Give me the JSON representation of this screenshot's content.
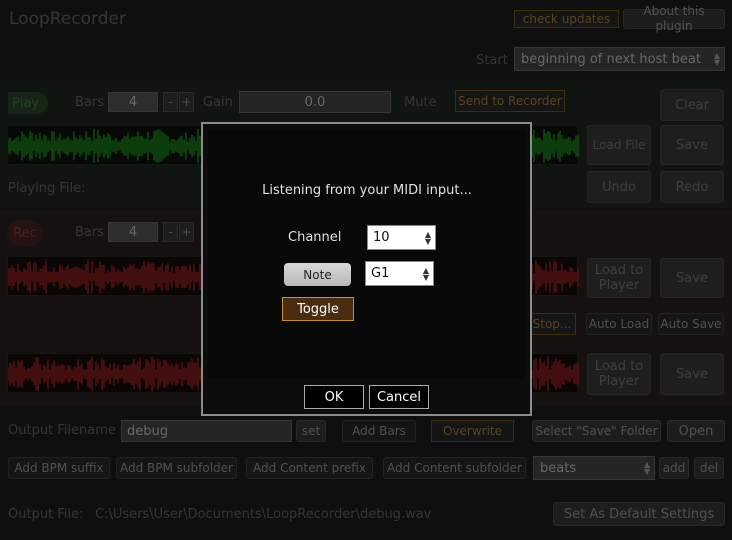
{
  "header": {
    "title": "LoopRecorder",
    "check_updates": "check updates",
    "about": "About this plugin"
  },
  "start": {
    "label": "Start",
    "value": "beginning of next host beat"
  },
  "play": {
    "play_label": "Play",
    "bars_label": "Bars",
    "bars_value": "4",
    "minus": "-",
    "plus": "+",
    "gain_label": "Gain",
    "gain_value": "0.0",
    "mute_label": "Mute",
    "send_to_recorder": "Send to Recorder",
    "clear": "Clear",
    "load_file": "Load File",
    "save": "Save",
    "playing_file_label": "Playing File:",
    "undo": "Undo",
    "redo": "Redo"
  },
  "rec": {
    "rec_label": "Rec",
    "bars_label": "Bars",
    "bars_value": "4",
    "minus": "-",
    "plus": "+",
    "load_to_player_1": "Load to Player",
    "save_1": "Save",
    "stop": "Stop...",
    "auto_load": "Auto Load",
    "auto_save": "Auto Save",
    "load_to_player_2": "Load to Player",
    "save_2": "Save"
  },
  "output": {
    "filename_label": "Output Filename",
    "filename_value": "debug",
    "set": "set",
    "add_bars": "Add Bars",
    "overwrite": "Overwrite",
    "select_save_folder": "Select \"Save\" Folder",
    "open": "Open",
    "add_bpm_suffix": "Add BPM suffix",
    "add_bpm_subfolder": "Add BPM subfolder",
    "add_content_prefix": "Add Content prefix",
    "add_content_subfolder": "Add Content subfolder",
    "content_select": "beats",
    "add": "add",
    "del": "del",
    "output_file_label": "Output File:",
    "output_file_path": "C:\\Users\\User\\Documents\\LoopRecorder\\debug.wav",
    "set_default": "Set As Default Settings"
  },
  "dialog": {
    "message": "Listening from your MIDI input...",
    "channel_label": "Channel",
    "channel_value": "10",
    "note_button": "Note",
    "note_value": "G1",
    "toggle": "Toggle",
    "ok": "OK",
    "cancel": "Cancel"
  },
  "colors": {
    "play_wave": "#1f9a1f",
    "rec_wave": "#a82020",
    "accent_orange": "#c8901c"
  }
}
